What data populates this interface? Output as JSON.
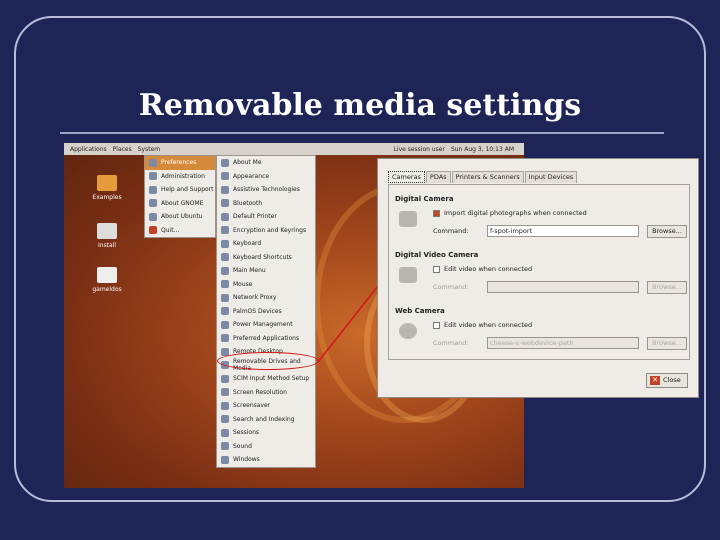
{
  "slide": {
    "title": "Removable media settings"
  },
  "panel": {
    "applications": "Applications",
    "places": "Places",
    "system": "System",
    "session": "Live session user",
    "clock": "Sun Aug 3, 10:13 AM"
  },
  "desktop_icons": [
    {
      "label": "Examples"
    },
    {
      "label": "Install"
    },
    {
      "label": "gameldos"
    }
  ],
  "system_menu": [
    {
      "label": "Preferences"
    },
    {
      "label": "Administration"
    },
    {
      "label": "Help and Support"
    },
    {
      "label": "About GNOME"
    },
    {
      "label": "About Ubuntu"
    },
    {
      "label": "Quit..."
    }
  ],
  "preferences_menu": [
    "About Me",
    "Appearance",
    "Assistive Technologies",
    "Bluetooth",
    "Default Printer",
    "Encryption and Keyrings",
    "Keyboard",
    "Keyboard Shortcuts",
    "Main Menu",
    "Mouse",
    "Network Proxy",
    "PalmOS Devices",
    "Power Management",
    "Preferred Applications",
    "Remote Desktop",
    "Removable Drives and Media",
    "SCIM Input Method Setup",
    "Screen Resolution",
    "Screensaver",
    "Search and Indexing",
    "Sessions",
    "Sound",
    "Windows"
  ],
  "dialog": {
    "tabs": [
      "Cameras",
      "PDAs",
      "Printers & Scanners",
      "Input Devices"
    ],
    "digital_camera": {
      "heading": "Digital Camera",
      "checkbox": "Import digital photographs when connected",
      "command_label": "Command:",
      "command_value": "f-spot-import",
      "browse": "Browse..."
    },
    "video_camera": {
      "heading": "Digital Video Camera",
      "checkbox": "Edit video when connected",
      "command_label": "Command:",
      "command_value": "",
      "browse": "Browse..."
    },
    "web_camera": {
      "heading": "Web Camera",
      "checkbox": "Edit video when connected",
      "command_label": "Command:",
      "command_value": "cheese-x-webdevice-path",
      "browse": "Browse..."
    },
    "close": "Close"
  },
  "colors": {
    "background": "#1f2456",
    "highlight": "#d31818",
    "menu_highlight": "#d48a3a"
  }
}
